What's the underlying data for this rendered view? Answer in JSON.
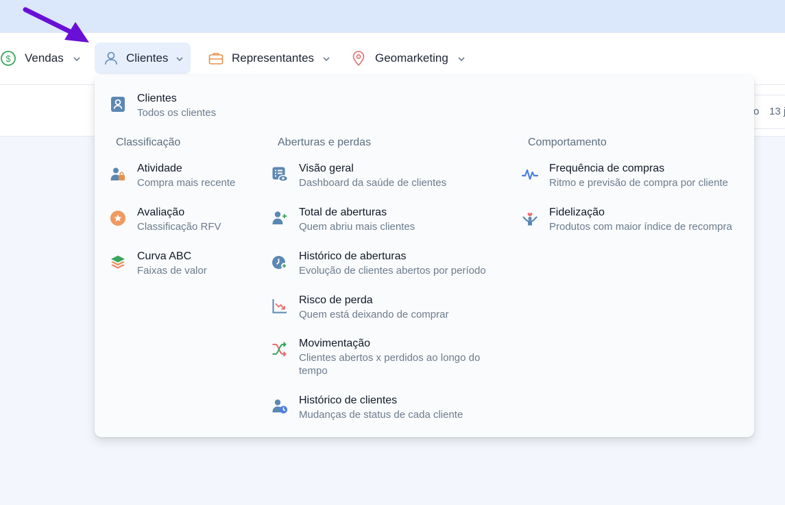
{
  "nav": {
    "items": [
      {
        "label": "Vendas",
        "icon": "dollar-circle-icon"
      },
      {
        "label": "Clientes",
        "icon": "user-icon",
        "active": true
      },
      {
        "label": "Representantes",
        "icon": "briefcase-icon"
      },
      {
        "label": "Geomarketing",
        "icon": "map-pin-icon"
      }
    ]
  },
  "background": {
    "partial_text_1": "o",
    "partial_text_2": "13 j"
  },
  "menu": {
    "main": {
      "title": "Clientes",
      "subtitle": "Todos os clientes"
    },
    "sections": {
      "classificacao": "Classificação",
      "aberturas": "Aberturas e perdas",
      "comportamento": "Comportamento"
    },
    "classificacao": [
      {
        "title": "Atividade",
        "subtitle": "Compra mais recente"
      },
      {
        "title": "Avaliação",
        "subtitle": "Classificação RFV"
      },
      {
        "title": "Curva ABC",
        "subtitle": "Faixas de valor"
      }
    ],
    "aberturas": [
      {
        "title": "Visão geral",
        "subtitle": "Dashboard da saúde de clientes"
      },
      {
        "title": "Total de aberturas",
        "subtitle": "Quem abriu mais clientes"
      },
      {
        "title": "Histórico de aberturas",
        "subtitle": "Evolução de clientes abertos por período"
      },
      {
        "title": "Risco de perda",
        "subtitle": "Quem está deixando de comprar"
      },
      {
        "title": "Movimentação",
        "subtitle_line1": "Clientes abertos x perdidos ao longo do",
        "subtitle_line2": "tempo"
      },
      {
        "title": "Histórico de clientes",
        "subtitle": "Mudanças de status de cada cliente"
      }
    ],
    "comportamento": [
      {
        "title": "Frequência de compras",
        "subtitle": "Ritmo e previsão de compra por cliente"
      },
      {
        "title": "Fidelização",
        "subtitle": "Produtos com maior índice de recompra"
      }
    ]
  },
  "colors": {
    "accent": "#6a0fd6",
    "icon_blue": "#5b87b3",
    "active_bg": "#e6effb"
  }
}
